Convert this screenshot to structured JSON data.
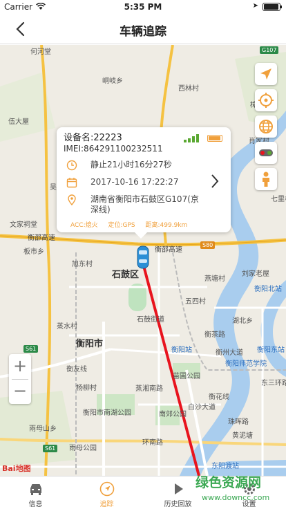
{
  "status_bar": {
    "carrier": "Carrier",
    "time": "5:35 PM"
  },
  "nav": {
    "title": "车辆追踪"
  },
  "popup": {
    "device_name": "设备名:22223",
    "imei": "IMEI:864291100232511",
    "status": "静止21小时16分27秒",
    "datetime": "2017-10-16 17:22:27",
    "address": "湖南省衡阳市石鼓区G107(京深线)",
    "acc": "ACC:熄火",
    "positioning": "定位:GPS",
    "distance": "距离:499.9km",
    "colors": {
      "accent": "#f0a03c",
      "signal": "#5aa832"
    }
  },
  "map": {
    "labels": [
      "何河堂",
      "峒岐乡",
      "西林村",
      "樟木乡",
      "伍大屋",
      "肖家村",
      "吴家",
      "七里村",
      "文家祠堂",
      "衡邵高速",
      "板市乡",
      "衡邵高速",
      "刘家老屋",
      "旭东村",
      "石鼓区",
      "燕塘村",
      "五四村",
      "衡阳北站",
      "石鼓街道",
      "湖北乡",
      "衡茶路",
      "衡阳站",
      "衡阳东站",
      "衡阳市",
      "蒸水村",
      "衡州大道",
      "衡阳师范学院",
      "衡友线",
      "杨柳村",
      "苗圃公园",
      "东三环路",
      "蒸湘南路",
      "白沙大道",
      "衡阳市南湖公园",
      "南郊公园",
      "雨母山乡",
      "珠晖路",
      "黄泥塘",
      "衡花线",
      "环南路",
      "雨母公园",
      "东阳渡站"
    ],
    "road_badges": [
      "G107",
      "S80",
      "S61",
      "S61"
    ],
    "logo": "Bai地图"
  },
  "map_tools": [
    "locate-arrow-icon",
    "target-icon",
    "globe-icon",
    "traffic-light-icon",
    "person-icon"
  ],
  "zoom": {
    "in": "+",
    "out": "−"
  },
  "tabs": [
    {
      "label": "信息",
      "icon": "car-icon",
      "active": false
    },
    {
      "label": "追踪",
      "icon": "navigation-icon",
      "active": true
    },
    {
      "label": "历史回放",
      "icon": "play-icon",
      "active": false
    },
    {
      "label": "设置",
      "icon": "gear-icon",
      "active": false
    }
  ],
  "watermark": {
    "text": "绿色资源网",
    "url": "www.downcc.com"
  }
}
